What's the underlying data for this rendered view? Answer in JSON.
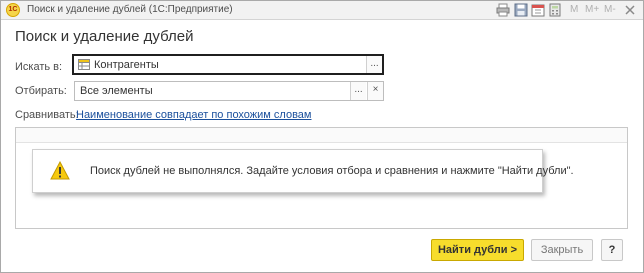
{
  "window": {
    "title": "Поиск и удаление дублей  (1С:Предприятие)",
    "logo_text": "1С",
    "toolbar": {
      "icons": [
        "print-icon",
        "save-icon",
        "calendar-icon",
        "calculator-icon"
      ],
      "memory_labels": [
        "M",
        "M+",
        "M-"
      ]
    }
  },
  "form": {
    "title": "Поиск и удаление дублей",
    "search_in": {
      "label": "Искать в:",
      "value": "Контрагенты",
      "choose_button": "..."
    },
    "filter": {
      "label": "Отбирать:",
      "value": "Все элементы",
      "choose_button": "...",
      "clear_button": "×"
    },
    "compare": {
      "label": "Сравнивать:",
      "link": "Наименование совпадает по похожим словам"
    },
    "message": {
      "text": "Поиск дублей не выполнялся.  Задайте условия отбора и сравнения и нажмите \"Найти дубли\"."
    }
  },
  "buttons": {
    "find": "Найти дубли >",
    "close": "Закрыть",
    "help": "?"
  },
  "colors": {
    "primary_button": "#f7dd2c",
    "link": "#1a4f9c",
    "focus_border": "#1f1f1f",
    "warning": "#f2c200"
  }
}
